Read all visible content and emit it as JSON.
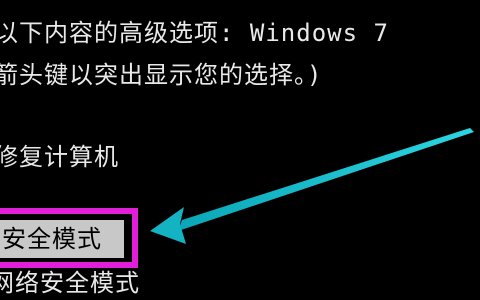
{
  "boot_menu": {
    "line1": "以下内容的高级选项: Windows 7",
    "line2": "箭头键以突出显示您的选择。)",
    "item_repair": "修复计算机",
    "item_safe_mode": "安全模式",
    "item_safe_mode_networking_partial": "网络安全模式"
  },
  "colors": {
    "background": "#000000",
    "text": "#e9e9e9",
    "highlight_bg": "#c8c8c8",
    "annotation_box": "#e11fd8",
    "annotation_arrow": "#15b9c9"
  },
  "icons": [
    "annotation-arrow-icon"
  ]
}
